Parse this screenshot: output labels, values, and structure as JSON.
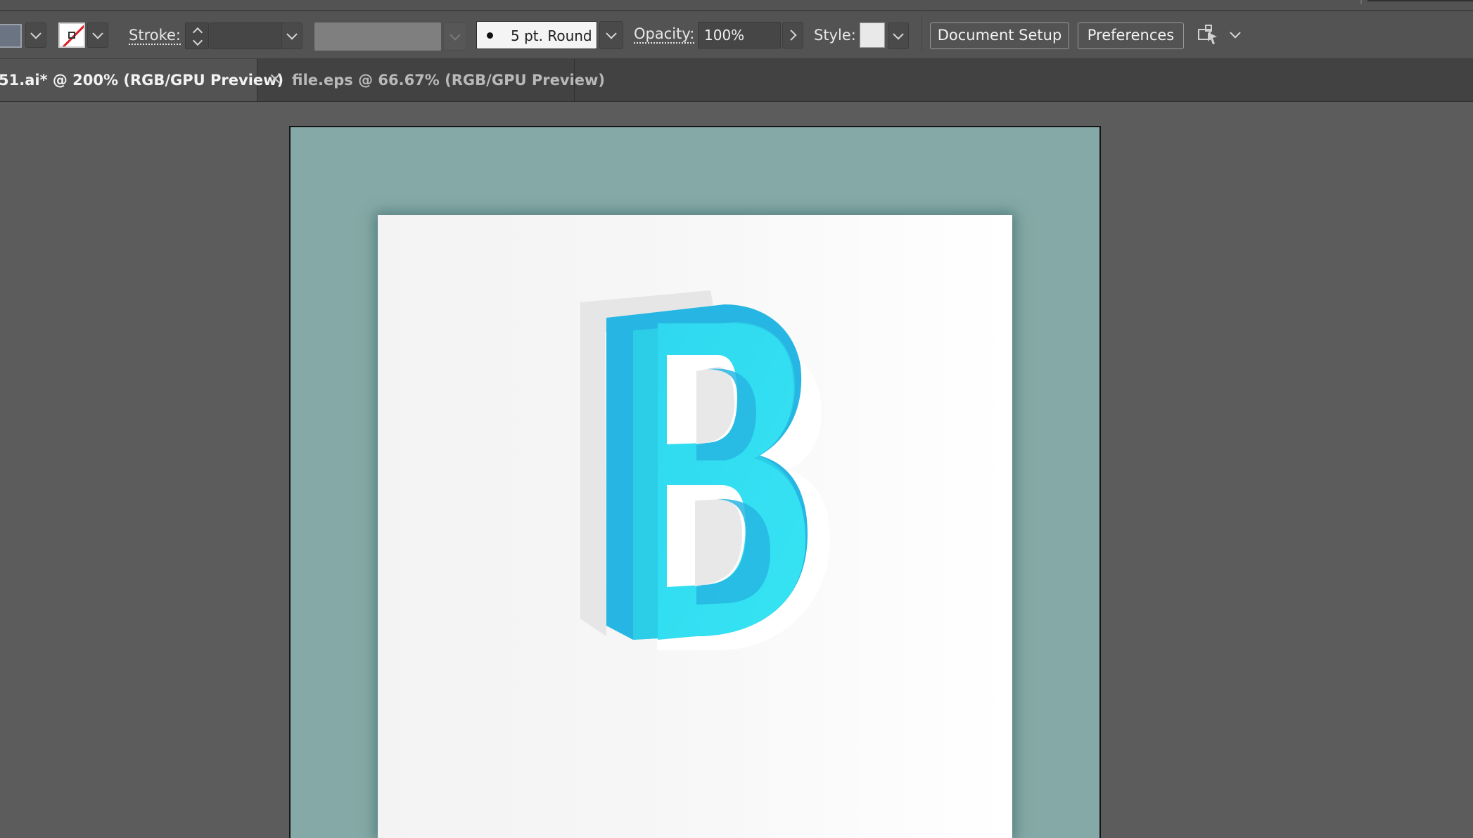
{
  "control_bar": {
    "stroke_label": "Stroke:",
    "stroke_weight": "",
    "brush_label": "5 pt. Round",
    "opacity_label": "Opacity:",
    "opacity_value": "100%",
    "style_label": "Style:",
    "document_setup_label": "Document Setup",
    "preferences_label": "Preferences",
    "fill_color": "#6b7482",
    "stroke_color": "none"
  },
  "tabs": [
    {
      "title": "51.ai* @ 200% (RGB/GPU Preview)",
      "active": true
    },
    {
      "title": "file.eps @ 66.67% (RGB/GPU Preview)",
      "active": false,
      "close_glyph": "✕"
    }
  ],
  "canvas": {
    "artboard_bg_color": "#85a9a6",
    "paper_color": "#f7f7f7",
    "artwork_letter": "B",
    "artwork_colors": [
      "#27b6e3",
      "#2ccde7",
      "#38e1f1",
      "#e7e7e7"
    ]
  }
}
